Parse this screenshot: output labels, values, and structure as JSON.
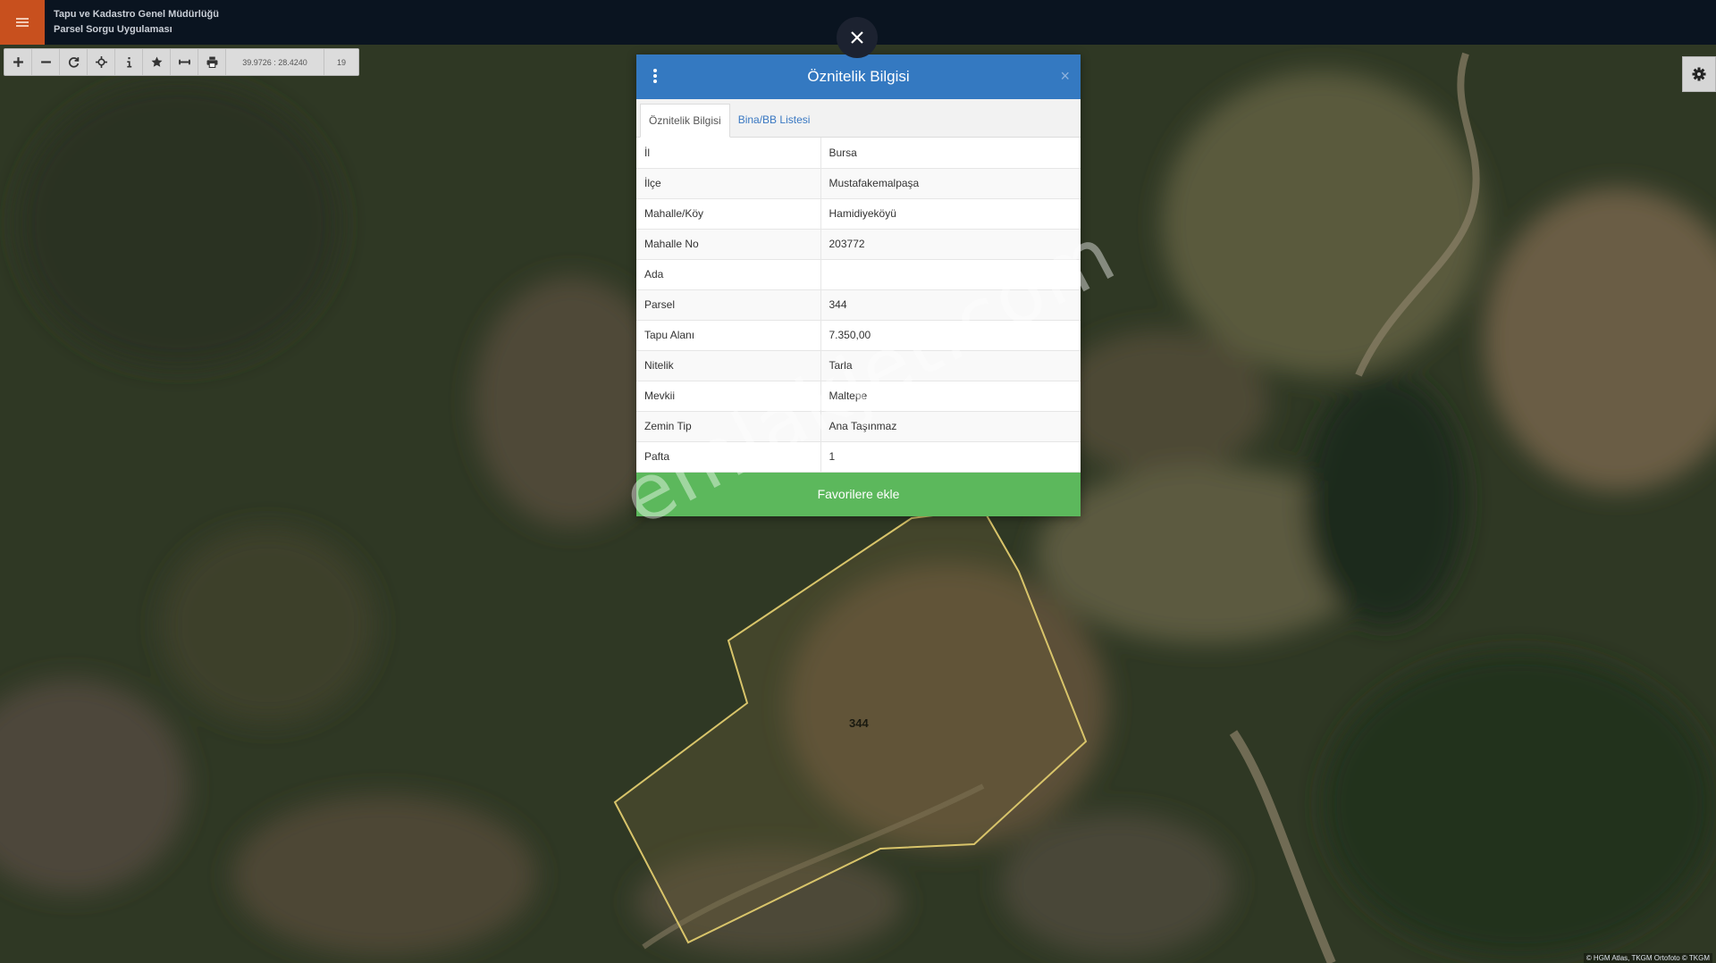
{
  "header": {
    "brand_line1": "Tapu ve Kadastro Genel Müdürlüğü",
    "brand_line2": "Parsel Sorgu Uygulaması"
  },
  "toolbar": {
    "buttons": [
      "zoom-in",
      "zoom-out",
      "refresh",
      "locate",
      "info",
      "favorite",
      "measure",
      "print"
    ],
    "coordinates": "39.9726 : 28.4240",
    "zoom_level": "19"
  },
  "dialog": {
    "title": "Öznitelik Bilgisi",
    "close_symbol": "×",
    "tabs": [
      {
        "label": "Öznitelik Bilgisi",
        "active": true
      },
      {
        "label": "Bina/BB Listesi",
        "active": false
      }
    ],
    "rows": [
      {
        "key": "İl",
        "value": "Bursa"
      },
      {
        "key": "İlçe",
        "value": "Mustafakemalpaşa"
      },
      {
        "key": "Mahalle/Köy",
        "value": "Hamidiyeköyü"
      },
      {
        "key": "Mahalle No",
        "value": "203772"
      },
      {
        "key": "Ada",
        "value": ""
      },
      {
        "key": "Parsel",
        "value": "344"
      },
      {
        "key": "Tapu Alanı",
        "value": "7.350,00"
      },
      {
        "key": "Nitelik",
        "value": "Tarla"
      },
      {
        "key": "Mevkii",
        "value": "Maltepe"
      },
      {
        "key": "Zemin Tip",
        "value": "Ana Taşınmaz"
      },
      {
        "key": "Pafta",
        "value": "1"
      }
    ],
    "favorite_button": "Favorilere ekle"
  },
  "map": {
    "parcel_label": "344",
    "attribution": "© HGM Atlas, TKGM Ortofoto © TKGM",
    "watermark": "emlakjet.com"
  },
  "colors": {
    "header_bg": "#0a1420",
    "menu_accent": "#c8501e",
    "dialog_header": "#3479c1",
    "favorite_button": "#5cb85c",
    "parcel_outline": "#d8c46a"
  },
  "icons": {
    "menu": "hamburger-icon",
    "overlay_close": "close-icon",
    "settings": "gear-icon",
    "dialog_menu": "kebab-icon"
  }
}
